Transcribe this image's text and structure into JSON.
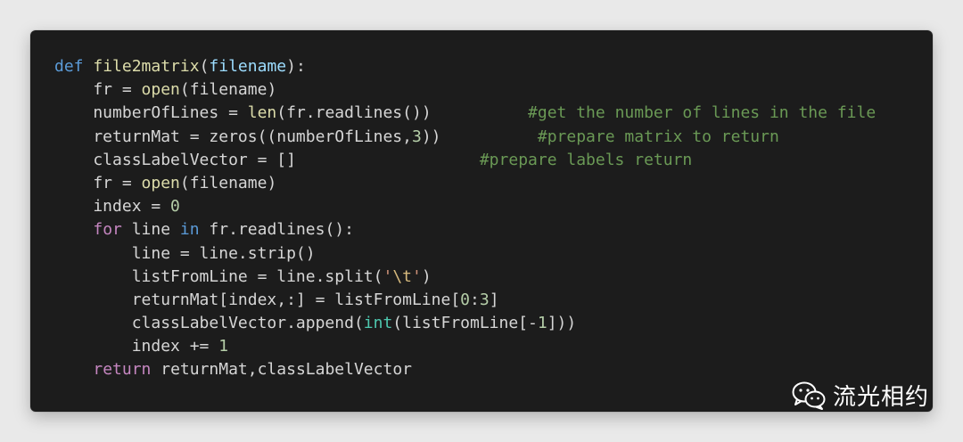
{
  "code": {
    "language": "python",
    "lines": [
      {
        "tokens": [
          {
            "t": "def",
            "c": "kw"
          },
          {
            "t": " ",
            "c": "plain"
          },
          {
            "t": "file2matrix",
            "c": "fn"
          },
          {
            "t": "(",
            "c": "plain"
          },
          {
            "t": "filename",
            "c": "param"
          },
          {
            "t": "):",
            "c": "plain"
          }
        ]
      },
      {
        "tokens": [
          {
            "t": "    fr = ",
            "c": "plain"
          },
          {
            "t": "open",
            "c": "fn"
          },
          {
            "t": "(filename)",
            "c": "plain"
          }
        ]
      },
      {
        "tokens": [
          {
            "t": "    numberOfLines = ",
            "c": "plain"
          },
          {
            "t": "len",
            "c": "fn"
          },
          {
            "t": "(fr.readlines())",
            "c": "plain"
          },
          {
            "t": "          ",
            "c": "plain"
          },
          {
            "t": "#get the number of lines in the file",
            "c": "comment"
          }
        ]
      },
      {
        "tokens": [
          {
            "t": "    returnMat = zeros((numberOfLines,",
            "c": "plain"
          },
          {
            "t": "3",
            "c": "num"
          },
          {
            "t": "))",
            "c": "plain"
          },
          {
            "t": "          ",
            "c": "plain"
          },
          {
            "t": "#prepare matrix to return",
            "c": "comment"
          }
        ]
      },
      {
        "tokens": [
          {
            "t": "    classLabelVector = []",
            "c": "plain"
          },
          {
            "t": "                   ",
            "c": "plain"
          },
          {
            "t": "#prepare labels return",
            "c": "comment"
          }
        ]
      },
      {
        "tokens": [
          {
            "t": "    fr = ",
            "c": "plain"
          },
          {
            "t": "open",
            "c": "fn"
          },
          {
            "t": "(filename)",
            "c": "plain"
          }
        ]
      },
      {
        "tokens": [
          {
            "t": "    index = ",
            "c": "plain"
          },
          {
            "t": "0",
            "c": "num"
          }
        ]
      },
      {
        "tokens": [
          {
            "t": "    ",
            "c": "plain"
          },
          {
            "t": "for",
            "c": "ret"
          },
          {
            "t": " line ",
            "c": "plain"
          },
          {
            "t": "in",
            "c": "kw"
          },
          {
            "t": " fr.readlines():",
            "c": "plain"
          }
        ]
      },
      {
        "tokens": [
          {
            "t": "        line = line.strip()",
            "c": "plain"
          }
        ]
      },
      {
        "tokens": [
          {
            "t": "        listFromLine = line.split(",
            "c": "plain"
          },
          {
            "t": "'",
            "c": "str"
          },
          {
            "t": "\\t",
            "c": "esc"
          },
          {
            "t": "'",
            "c": "str"
          },
          {
            "t": ")",
            "c": "plain"
          }
        ]
      },
      {
        "tokens": [
          {
            "t": "        returnMat[index,:] = listFromLine[",
            "c": "plain"
          },
          {
            "t": "0",
            "c": "num"
          },
          {
            "t": ":",
            "c": "plain"
          },
          {
            "t": "3",
            "c": "num"
          },
          {
            "t": "]",
            "c": "plain"
          }
        ]
      },
      {
        "tokens": [
          {
            "t": "        classLabelVector.append(",
            "c": "plain"
          },
          {
            "t": "int",
            "c": "builtin"
          },
          {
            "t": "(listFromLine[-",
            "c": "plain"
          },
          {
            "t": "1",
            "c": "num"
          },
          {
            "t": "]))",
            "c": "plain"
          }
        ]
      },
      {
        "tokens": [
          {
            "t": "        index += ",
            "c": "plain"
          },
          {
            "t": "1",
            "c": "num"
          }
        ]
      },
      {
        "tokens": [
          {
            "t": "    ",
            "c": "plain"
          },
          {
            "t": "return",
            "c": "ret"
          },
          {
            "t": " returnMat,classLabelVector",
            "c": "plain"
          }
        ]
      }
    ]
  },
  "watermark": {
    "icon": "wechat-icon",
    "text": "流光相约"
  },
  "colors": {
    "background": "#e9e9e9",
    "editor_bg": "#1c1c1c",
    "keyword": "#5b9bd8",
    "control": "#c586c0",
    "function": "#dcdcaa",
    "param": "#9cdcfe",
    "number": "#b5cea8",
    "string": "#ce9178",
    "comment": "#6a9955"
  }
}
